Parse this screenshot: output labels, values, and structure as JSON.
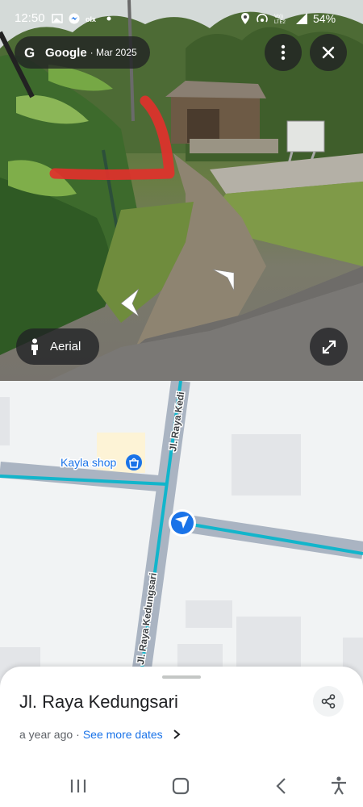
{
  "status_bar": {
    "time": "12:50",
    "battery": "54%",
    "left_icons": [
      "image-icon",
      "messenger-icon",
      "olx-icon",
      "dot-icon"
    ],
    "right_icons": [
      "location-icon",
      "hotspot-icon",
      "volte-icon",
      "signal-icon",
      "battery-icon"
    ]
  },
  "streetview": {
    "brand": "Google",
    "date": "· Mar 2025",
    "aerial_label": "Aerial",
    "more_icon": "more-vert-icon",
    "close_icon": "close-icon",
    "expand_icon": "expand-icon"
  },
  "map": {
    "place_label": "Kayla shop",
    "road_top": "Jl. Raya Kedungsari",
    "road_bottom": "Jl. Raya Kedungsari",
    "road_top_short": "Jl. Raya Kedi",
    "colors": {
      "route": "#12b5cb",
      "road": "#aab4c2",
      "pin": "#1a73e8",
      "shop": "#1a73e8"
    }
  },
  "sheet": {
    "title": "Jl. Raya Kedungsari",
    "subtitle": "a year ago",
    "separator": "·",
    "link": "See more dates",
    "link_color": "#1a73e8"
  },
  "nav_bar": {
    "icons": [
      "recents-icon",
      "home-icon",
      "back-icon",
      "accessibility-icon"
    ]
  }
}
